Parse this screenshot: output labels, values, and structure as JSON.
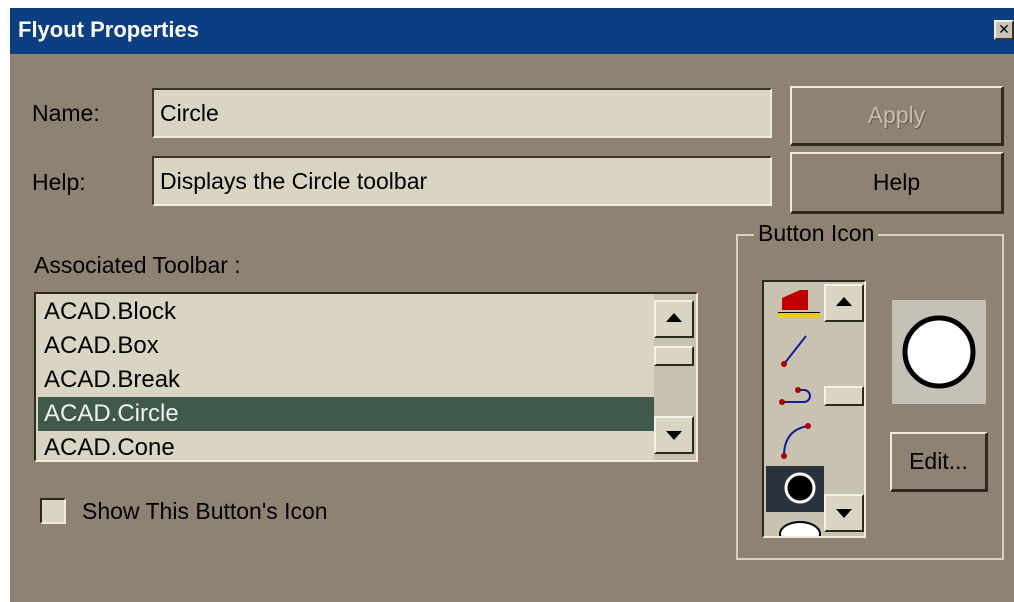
{
  "window": {
    "title": "Flyout Properties",
    "close_glyph": "✕"
  },
  "form": {
    "name_label": "Name:",
    "name_value": "Circle",
    "help_label": "Help:",
    "help_value": "Displays the Circle toolbar",
    "associated_label": "Associated Toolbar :",
    "toolbars": [
      "ACAD.Block",
      "ACAD.Box",
      "ACAD.Break",
      "ACAD.Circle",
      "ACAD.Cone"
    ],
    "selected_toolbar": "ACAD.Circle",
    "show_icon_label": "Show This Button's Icon",
    "show_icon_checked": false
  },
  "buttons": {
    "apply": "Apply",
    "apply_enabled": false,
    "help": "Help",
    "edit": "Edit..."
  },
  "button_icon": {
    "group_label": "Button Icon",
    "icons": [
      "box-icon",
      "line-icon",
      "break-icon",
      "arc-icon",
      "circle-icon",
      "ellipse-icon"
    ],
    "selected_icon": "circle-icon",
    "preview_icon": "circle-icon"
  },
  "colors": {
    "titlebar": "#0c3e82",
    "face": "#8f8272",
    "field": "#d9d5c2",
    "selection": "#3f5a4c"
  }
}
